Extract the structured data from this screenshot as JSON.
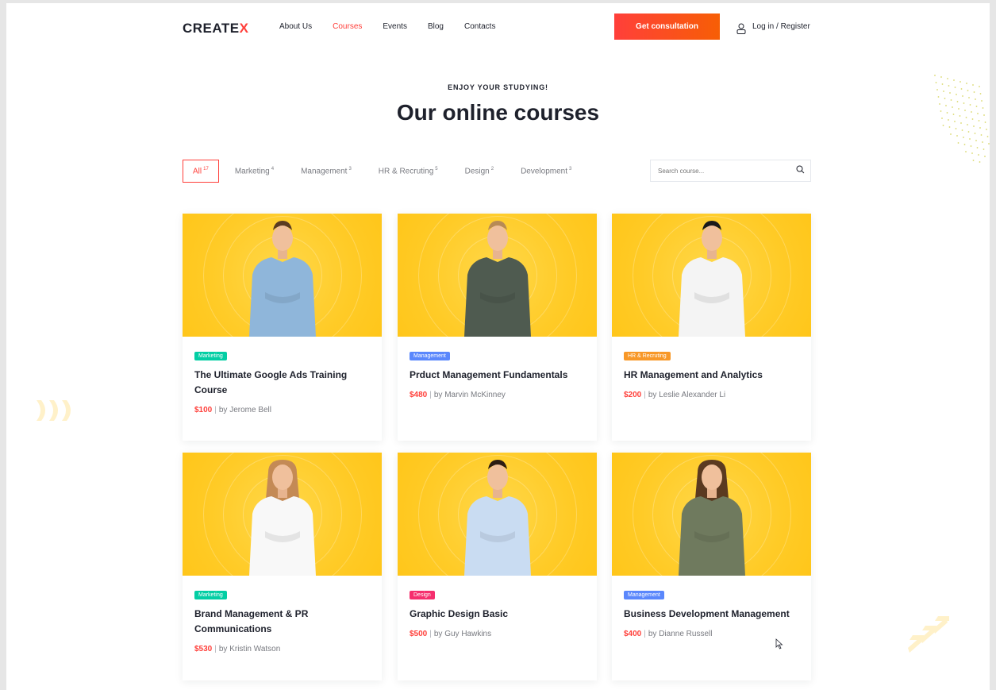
{
  "header": {
    "logo_text": "CREATE",
    "logo_mark": "X",
    "nav": [
      {
        "label": "About Us"
      },
      {
        "label": "Courses"
      },
      {
        "label": "Events"
      },
      {
        "label": "Blog"
      },
      {
        "label": "Contacts"
      }
    ],
    "active_nav": "Courses",
    "cta_label": "Get consultation",
    "login_label": "Log in / Register",
    "user_icon": "user-icon"
  },
  "hero": {
    "eyebrow": "ENJOY YOUR STUDYING!",
    "title": "Our online courses"
  },
  "filters": [
    {
      "label": "All",
      "count": "17"
    },
    {
      "label": "Marketing",
      "count": "4"
    },
    {
      "label": "Management",
      "count": "3"
    },
    {
      "label": "HR & Recruting",
      "count": "5"
    },
    {
      "label": "Design",
      "count": "2"
    },
    {
      "label": "Development",
      "count": "3"
    }
  ],
  "active_filter": "All",
  "search": {
    "placeholder": "Search course...",
    "icon": "search-icon"
  },
  "courses": [
    {
      "tag": "Marketing",
      "tag_color": "#03cea4",
      "title": "The Ultimate Google Ads Training Course",
      "price": "$100",
      "author": "by Jerome Bell",
      "shirt": "#8fb6da",
      "hair": "#5a3b22"
    },
    {
      "tag": "Management",
      "tag_color": "#5a87fc",
      "title": "Prduct Management Fundamentals",
      "price": "$480",
      "author": "by Marvin McKinney",
      "shirt": "#4f5b50",
      "hair": "#b78a55"
    },
    {
      "tag": "HR & Recruting",
      "tag_color": "#f89828",
      "title": "HR  Management and Analytics",
      "price": "$200",
      "author": "by Leslie Alexander Li",
      "shirt": "#f4f4f4",
      "hair": "#1a1a1a"
    },
    {
      "tag": "Marketing",
      "tag_color": "#03cea4",
      "title": "Brand Management & PR Communications",
      "price": "$530",
      "author": "by Kristin Watson",
      "shirt": "#f8f8f8",
      "hair": "#c48a55"
    },
    {
      "tag": "Design",
      "tag_color": "#f52f6e",
      "title": "Graphic Design Basic",
      "price": "$500",
      "author": "by Guy Hawkins",
      "shirt": "#c9dcf2",
      "hair": "#2b1c13"
    },
    {
      "tag": "Management",
      "tag_color": "#5a87fc",
      "title": "Business Development Management",
      "price": "$400",
      "author": "by Dianne Russell",
      "shirt": "#6f7a5e",
      "hair": "#5b3a20"
    }
  ],
  "colors": {
    "accent": "#ff3f3a",
    "text": "#1e212c",
    "muted": "#787a80",
    "thumb_yellow": "#ffcb27"
  }
}
